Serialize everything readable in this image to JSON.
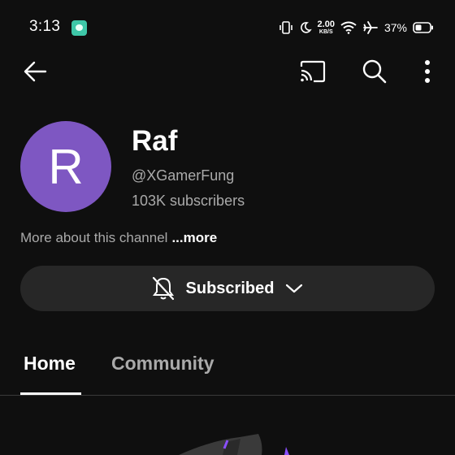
{
  "status_bar": {
    "time": "3:13",
    "net_speed_value": "2.00",
    "net_speed_unit": "KB/S",
    "battery_percent": "37%",
    "icons": [
      "app-notification-icon",
      "vibrate-icon",
      "do-not-disturb-moon-icon",
      "wifi-icon",
      "airplane-mode-icon",
      "battery-icon"
    ]
  },
  "toolbar": {
    "icons": [
      "back-arrow-icon",
      "cast-icon",
      "search-icon",
      "more-options-icon"
    ]
  },
  "channel": {
    "avatar_letter": "R",
    "avatar_color": "#7e57c2",
    "name": "Raf",
    "handle": "@XGamerFung",
    "subscribers": "103K subscribers",
    "more_about": "More about this channel",
    "more_link": "...more"
  },
  "subscribe": {
    "label": "Subscribed",
    "icons": [
      "notifications-off-icon",
      "chevron-down-icon"
    ]
  },
  "tabs": [
    {
      "label": "Home",
      "selected": true
    },
    {
      "label": "Community",
      "selected": false
    }
  ],
  "colors": {
    "background": "#0f0f0f",
    "button_bg": "#272727",
    "secondary_text": "#aaaaaa",
    "accent_purple": "#8a4fff"
  }
}
